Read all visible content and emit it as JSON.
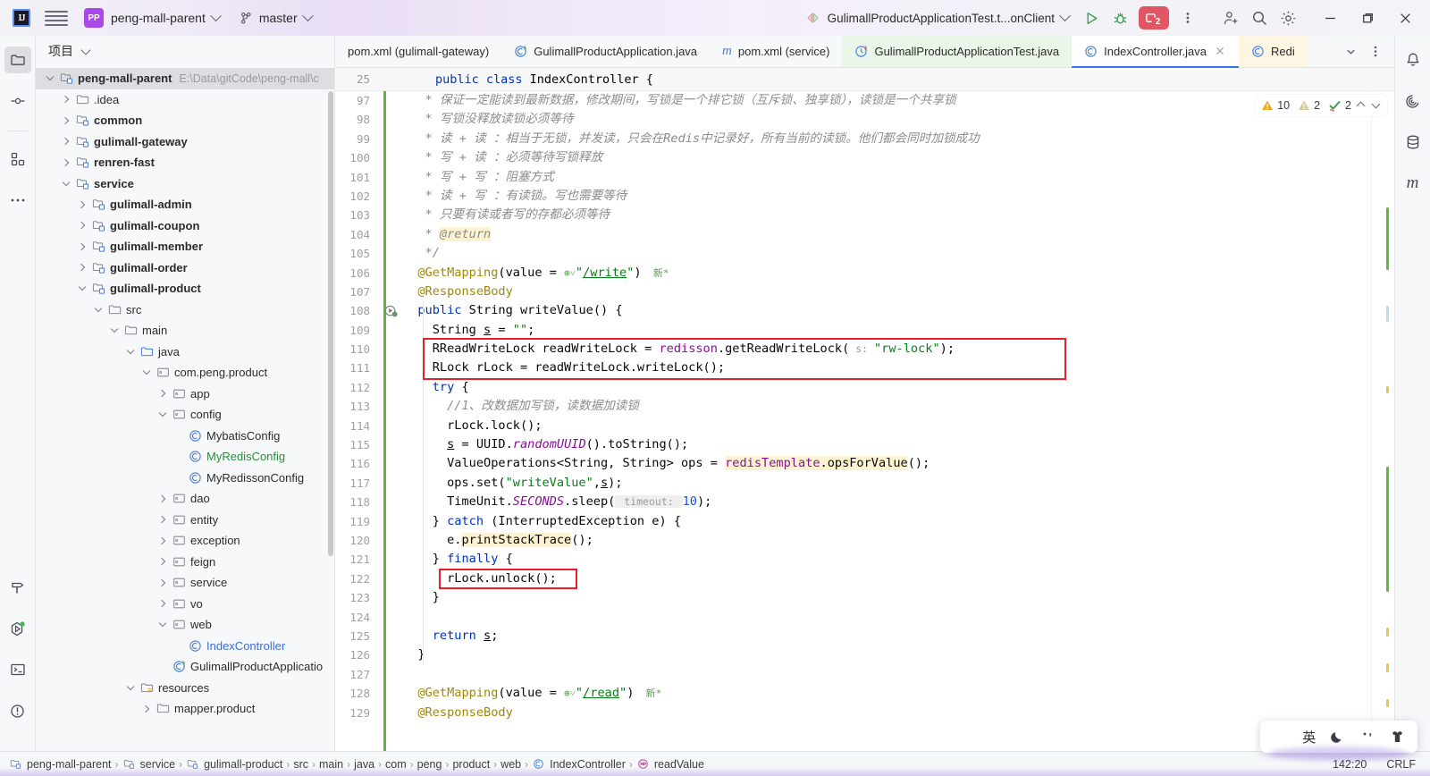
{
  "titlebar": {
    "ide_badge": "IJ",
    "project_badge": "PP",
    "project_name": "peng-mall-parent",
    "branch": "master",
    "run_config": "GulimallProductApplicationTest.t...onClient",
    "debug_count": "2",
    "icons": [
      "hamburger-menu-icon",
      "project-chevron-icon",
      "git-branch-icon",
      "run-icon",
      "debug-icon",
      "debug-session-badge",
      "more-options-icon",
      "add-user-icon",
      "search-icon",
      "settings-gear-icon",
      "minimize-icon",
      "maximize-icon",
      "close-icon"
    ]
  },
  "left_stripe": {
    "items": [
      {
        "name": "project-folder-icon",
        "active": true
      },
      {
        "name": "commit-icon",
        "active": false
      },
      {
        "name": "structure-icon",
        "active": false
      },
      {
        "name": "more-tool-windows-icon",
        "active": false
      }
    ],
    "bottom_items": [
      {
        "name": "build-hammer-icon"
      },
      {
        "name": "run-services-icon"
      },
      {
        "name": "terminal-icon"
      },
      {
        "name": "problems-icon"
      }
    ]
  },
  "right_stripe": {
    "items": [
      {
        "name": "notifications-bell-icon"
      },
      {
        "name": "maven-icon"
      },
      {
        "name": "database-icon"
      },
      {
        "name": "maven-m-icon"
      }
    ]
  },
  "project_panel": {
    "title": "项目",
    "tree": [
      {
        "depth": 0,
        "arrow": "open",
        "icon": "module-icon",
        "label": "peng-mall-parent",
        "bold": true,
        "path": "E:\\Data\\gitCode\\peng-mall\\c",
        "selected": true
      },
      {
        "depth": 1,
        "arrow": "closed",
        "icon": "folder-icon",
        "label": ".idea",
        "bold": false
      },
      {
        "depth": 1,
        "arrow": "closed",
        "icon": "module-icon",
        "label": "common",
        "bold": true
      },
      {
        "depth": 1,
        "arrow": "closed",
        "icon": "module-icon",
        "label": "gulimall-gateway",
        "bold": true
      },
      {
        "depth": 1,
        "arrow": "closed",
        "icon": "module-icon",
        "label": "renren-fast",
        "bold": true
      },
      {
        "depth": 1,
        "arrow": "open",
        "icon": "module-icon",
        "label": "service",
        "bold": true
      },
      {
        "depth": 2,
        "arrow": "closed",
        "icon": "module-icon",
        "label": "gulimall-admin",
        "bold": true
      },
      {
        "depth": 2,
        "arrow": "closed",
        "icon": "module-icon",
        "label": "gulimall-coupon",
        "bold": true
      },
      {
        "depth": 2,
        "arrow": "closed",
        "icon": "module-icon",
        "label": "gulimall-member",
        "bold": true
      },
      {
        "depth": 2,
        "arrow": "closed",
        "icon": "module-icon",
        "label": "gulimall-order",
        "bold": true
      },
      {
        "depth": 2,
        "arrow": "open",
        "icon": "module-icon",
        "label": "gulimall-product",
        "bold": true
      },
      {
        "depth": 3,
        "arrow": "open",
        "icon": "folder-icon",
        "label": "src",
        "bold": false
      },
      {
        "depth": 4,
        "arrow": "open",
        "icon": "folder-icon",
        "label": "main",
        "bold": false
      },
      {
        "depth": 5,
        "arrow": "open",
        "icon": "source-root-icon",
        "label": "java",
        "bold": false
      },
      {
        "depth": 6,
        "arrow": "open",
        "icon": "package-icon",
        "label": "com.peng.product",
        "bold": false
      },
      {
        "depth": 7,
        "arrow": "closed",
        "icon": "package-icon",
        "label": "app",
        "bold": false
      },
      {
        "depth": 7,
        "arrow": "open",
        "icon": "package-icon",
        "label": "config",
        "bold": false
      },
      {
        "depth": 8,
        "arrow": "none",
        "icon": "class-icon",
        "label": "MybatisConfig",
        "bold": false
      },
      {
        "depth": 8,
        "arrow": "none",
        "icon": "class-icon",
        "label": "MyRedisConfig",
        "bold": false,
        "color": "green"
      },
      {
        "depth": 8,
        "arrow": "none",
        "icon": "class-icon",
        "label": "MyRedissonConfig",
        "bold": false
      },
      {
        "depth": 7,
        "arrow": "closed",
        "icon": "package-icon",
        "label": "dao",
        "bold": false
      },
      {
        "depth": 7,
        "arrow": "closed",
        "icon": "package-icon",
        "label": "entity",
        "bold": false
      },
      {
        "depth": 7,
        "arrow": "closed",
        "icon": "package-icon",
        "label": "exception",
        "bold": false
      },
      {
        "depth": 7,
        "arrow": "closed",
        "icon": "package-icon",
        "label": "feign",
        "bold": false
      },
      {
        "depth": 7,
        "arrow": "closed",
        "icon": "package-icon",
        "label": "service",
        "bold": false
      },
      {
        "depth": 7,
        "arrow": "closed",
        "icon": "package-icon",
        "label": "vo",
        "bold": false
      },
      {
        "depth": 7,
        "arrow": "open",
        "icon": "package-icon",
        "label": "web",
        "bold": false
      },
      {
        "depth": 8,
        "arrow": "none",
        "icon": "class-icon",
        "label": "IndexController",
        "bold": false,
        "color": "blue"
      },
      {
        "depth": 7,
        "arrow": "none",
        "icon": "spring-class-icon",
        "label": "GulimallProductApplicatio",
        "bold": false
      },
      {
        "depth": 5,
        "arrow": "open",
        "icon": "resource-root-icon",
        "label": "resources",
        "bold": false
      },
      {
        "depth": 6,
        "arrow": "closed",
        "icon": "folder-icon",
        "label": "mapper.product",
        "bold": false
      }
    ]
  },
  "tabs": [
    {
      "label": "pom.xml (gulimall-gateway)",
      "icon": "none",
      "state": "plain",
      "closable": false
    },
    {
      "label": "GulimallProductApplication.java",
      "icon": "spring-class-icon",
      "state": "plain",
      "closable": false
    },
    {
      "label": "pom.xml (service)",
      "icon": "maven-m-icon",
      "state": "plain",
      "closable": false
    },
    {
      "label": "GulimallProductApplicationTest.java",
      "icon": "test-class-icon",
      "state": "green",
      "closable": false
    },
    {
      "label": "IndexController.java",
      "icon": "class-icon",
      "state": "active",
      "closable": true
    },
    {
      "label": "Redi",
      "icon": "class-icon",
      "state": "cream",
      "closable": false
    }
  ],
  "tabs_right_buttons": [
    "tab-list-chevron-icon",
    "tab-options-icon"
  ],
  "sticky_header": {
    "line": "25",
    "text": "public class IndexController {"
  },
  "inspection_widget": {
    "warnings": "10",
    "weak_warnings": "2",
    "typos": "2"
  },
  "editor": {
    "first_line": 97,
    "code_lines": [
      {
        "n": "97",
        "segs": [
          {
            "t": "   * 保证一定能读到最新数据，修改期间，写锁是一个排它锁（互斥锁、独享锁），读锁是一个共享锁",
            "c": "cmt"
          }
        ]
      },
      {
        "n": "98",
        "segs": [
          {
            "t": "   * 写锁没释放读锁必须等待",
            "c": "cmt"
          }
        ]
      },
      {
        "n": "99",
        "segs": [
          {
            "t": "   * 读 + 读 ：相当于无锁，并发读，只会在Redis中记录好，所有当前的读锁。他们都会同时加锁成功",
            "c": "cmt"
          }
        ]
      },
      {
        "n": "100",
        "segs": [
          {
            "t": "   * 写 + 读 ：必须等待写锁释放",
            "c": "cmt"
          }
        ]
      },
      {
        "n": "101",
        "segs": [
          {
            "t": "   * 写 + 写 ：阻塞方式",
            "c": "cmt"
          }
        ]
      },
      {
        "n": "102",
        "segs": [
          {
            "t": "   * 读 + 写 ：有读锁。写也需要等待",
            "c": "cmt"
          }
        ]
      },
      {
        "n": "103",
        "segs": [
          {
            "t": "   * 只要有读或者写的存都必须等待",
            "c": "cmt"
          }
        ]
      },
      {
        "n": "104",
        "segs": [
          {
            "t": "   * ",
            "c": "cmt"
          },
          {
            "t": "@return",
            "c": "cmt hl"
          }
        ]
      },
      {
        "n": "105",
        "segs": [
          {
            "t": "   */",
            "c": "cmt"
          }
        ]
      },
      {
        "n": "106",
        "segs": [
          {
            "t": "  @GetMapping",
            "c": "anno"
          },
          {
            "t": "(",
            "c": "plain"
          },
          {
            "t": "value",
            "c": "plain"
          },
          {
            "t": " = ",
            "c": "plain"
          },
          {
            "t": "⊕˅",
            "c": "cnsign"
          },
          {
            "t": "\"",
            "c": "str"
          },
          {
            "t": "/write",
            "c": "ulink"
          },
          {
            "t": "\"",
            "c": "str"
          },
          {
            "t": ")",
            "c": "plain"
          },
          {
            "t": "  新",
            "c": "cnsign"
          },
          {
            "t": "*",
            "c": "cnsign"
          }
        ]
      },
      {
        "n": "107",
        "segs": [
          {
            "t": "  @ResponseBody",
            "c": "anno"
          }
        ]
      },
      {
        "n": "108",
        "segs": [
          {
            "t": "  public ",
            "c": "kw"
          },
          {
            "t": "String ",
            "c": "plain"
          },
          {
            "t": "writeValue",
            "c": "plain"
          },
          {
            "t": "() {",
            "c": "plain"
          }
        ]
      },
      {
        "n": "109",
        "segs": [
          {
            "t": "    String ",
            "c": "plain"
          },
          {
            "t": "s",
            "c": "plain u"
          },
          {
            "t": " = ",
            "c": "plain"
          },
          {
            "t": "\"\"",
            "c": "str"
          },
          {
            "t": ";",
            "c": "plain"
          }
        ]
      },
      {
        "n": "110",
        "segs": [
          {
            "t": "    RReadWriteLock readWriteLock = ",
            "c": "plain"
          },
          {
            "t": "redisson",
            "c": "fld"
          },
          {
            "t": ".getReadWriteLock(",
            "c": "plain"
          },
          {
            "t": " s: ",
            "c": "hintp"
          },
          {
            "t": "\"rw-lock\"",
            "c": "str"
          },
          {
            "t": ");",
            "c": "plain"
          }
        ]
      },
      {
        "n": "111",
        "segs": [
          {
            "t": "    RLock rLock = readWriteLock.writeLock();",
            "c": "plain"
          }
        ]
      },
      {
        "n": "112",
        "segs": [
          {
            "t": "    try",
            "c": "kw"
          },
          {
            "t": " {",
            "c": "plain"
          }
        ]
      },
      {
        "n": "113",
        "segs": [
          {
            "t": "      //1、改数据加写锁，读数据加读锁",
            "c": "cmt"
          }
        ]
      },
      {
        "n": "114",
        "segs": [
          {
            "t": "      rLock.lock();",
            "c": "plain"
          }
        ]
      },
      {
        "n": "115",
        "segs": [
          {
            "t": "      ",
            "c": "plain"
          },
          {
            "t": "s",
            "c": "plain u"
          },
          {
            "t": " = UUID.",
            "c": "plain"
          },
          {
            "t": "randomUUID",
            "c": "stat"
          },
          {
            "t": "().toString();",
            "c": "plain"
          }
        ]
      },
      {
        "n": "116",
        "segs": [
          {
            "t": "      ValueOperations<String, String> ops = ",
            "c": "plain"
          },
          {
            "t": "redisTemplate",
            "c": "fld hlm"
          },
          {
            "t": ".opsForValue",
            "c": "plain hlm"
          },
          {
            "t": "();",
            "c": "plain"
          }
        ]
      },
      {
        "n": "117",
        "segs": [
          {
            "t": "      ops.set(",
            "c": "plain"
          },
          {
            "t": "\"writeValue\"",
            "c": "str"
          },
          {
            "t": ",",
            "c": "plain"
          },
          {
            "t": "s",
            "c": "plain u"
          },
          {
            "t": ");",
            "c": "plain"
          }
        ]
      },
      {
        "n": "118",
        "segs": [
          {
            "t": "      TimeUnit.",
            "c": "plain"
          },
          {
            "t": "SECONDS",
            "c": "stat"
          },
          {
            "t": ".sleep(",
            "c": "plain"
          },
          {
            "t": " timeout: ",
            "c": "hint"
          },
          {
            "t": "10",
            "c": "num"
          },
          {
            "t": ");",
            "c": "plain"
          }
        ]
      },
      {
        "n": "119",
        "segs": [
          {
            "t": "    } ",
            "c": "plain"
          },
          {
            "t": "catch",
            "c": "kw"
          },
          {
            "t": " (InterruptedException e) {",
            "c": "plain"
          }
        ]
      },
      {
        "n": "120",
        "segs": [
          {
            "t": "      e.",
            "c": "plain"
          },
          {
            "t": "printStackTrace",
            "c": "plain hlm"
          },
          {
            "t": "();",
            "c": "plain"
          }
        ]
      },
      {
        "n": "121",
        "segs": [
          {
            "t": "    } ",
            "c": "plain"
          },
          {
            "t": "finally",
            "c": "kw"
          },
          {
            "t": " {",
            "c": "plain"
          }
        ]
      },
      {
        "n": "122",
        "segs": [
          {
            "t": "      rLock.unlock();",
            "c": "plain"
          }
        ]
      },
      {
        "n": "123",
        "segs": [
          {
            "t": "    }",
            "c": "plain"
          }
        ]
      },
      {
        "n": "124",
        "segs": [
          {
            "t": "",
            "c": "plain"
          }
        ]
      },
      {
        "n": "125",
        "segs": [
          {
            "t": "    ",
            "c": "plain"
          },
          {
            "t": "return",
            "c": "kw"
          },
          {
            "t": " ",
            "c": "plain"
          },
          {
            "t": "s",
            "c": "plain u"
          },
          {
            "t": ";",
            "c": "plain"
          }
        ]
      },
      {
        "n": "126",
        "segs": [
          {
            "t": "  }",
            "c": "plain"
          }
        ]
      },
      {
        "n": "127",
        "segs": [
          {
            "t": "",
            "c": "plain"
          }
        ]
      },
      {
        "n": "128",
        "segs": [
          {
            "t": "  @GetMapping",
            "c": "anno"
          },
          {
            "t": "(",
            "c": "plain"
          },
          {
            "t": "value",
            "c": "plain"
          },
          {
            "t": " = ",
            "c": "plain"
          },
          {
            "t": "⊕˅",
            "c": "cnsign"
          },
          {
            "t": "\"",
            "c": "str"
          },
          {
            "t": "/read",
            "c": "ulink"
          },
          {
            "t": "\"",
            "c": "str"
          },
          {
            "t": ")",
            "c": "plain"
          },
          {
            "t": "  新",
            "c": "cnsign"
          },
          {
            "t": "*",
            "c": "cnsign"
          }
        ]
      },
      {
        "n": "129",
        "segs": [
          {
            "t": "  @ResponseBody",
            "c": "anno"
          }
        ]
      }
    ],
    "gutter_run_icon_line": "108",
    "highlight_boxes": [
      {
        "name": "readwritelock-highlight-box",
        "from_line": "110",
        "to_line": "111"
      },
      {
        "name": "unlock-highlight-box",
        "from_line": "122",
        "to_line": "122"
      }
    ]
  },
  "statusbar": {
    "breadcrumb": [
      {
        "label": "peng-mall-parent",
        "icon": "module-icon"
      },
      {
        "label": "service",
        "icon": "module-icon"
      },
      {
        "label": "gulimall-product",
        "icon": "module-icon"
      },
      {
        "label": "src",
        "icon": "none"
      },
      {
        "label": "main",
        "icon": "none"
      },
      {
        "label": "java",
        "icon": "none"
      },
      {
        "label": "com",
        "icon": "none"
      },
      {
        "label": "peng",
        "icon": "none"
      },
      {
        "label": "product",
        "icon": "none"
      },
      {
        "label": "web",
        "icon": "none"
      },
      {
        "label": "IndexController",
        "icon": "class-icon"
      },
      {
        "label": "readValue",
        "icon": "method-icon"
      }
    ],
    "caret_position": "142:20",
    "line_separator": "CRLF"
  },
  "ime_popup": {
    "items": [
      "windows-logo-icon",
      "chinese-english-toggle",
      "moon-icon",
      "punctuation-icon",
      "ime-skin-icon"
    ],
    "mode_label": "英"
  },
  "colors": {
    "accent_blue": "#3574f0",
    "highlight_red": "#e8202a",
    "debug_red": "#e25563",
    "purple_badge": "#a94ae8",
    "green_run": "#59a869"
  }
}
